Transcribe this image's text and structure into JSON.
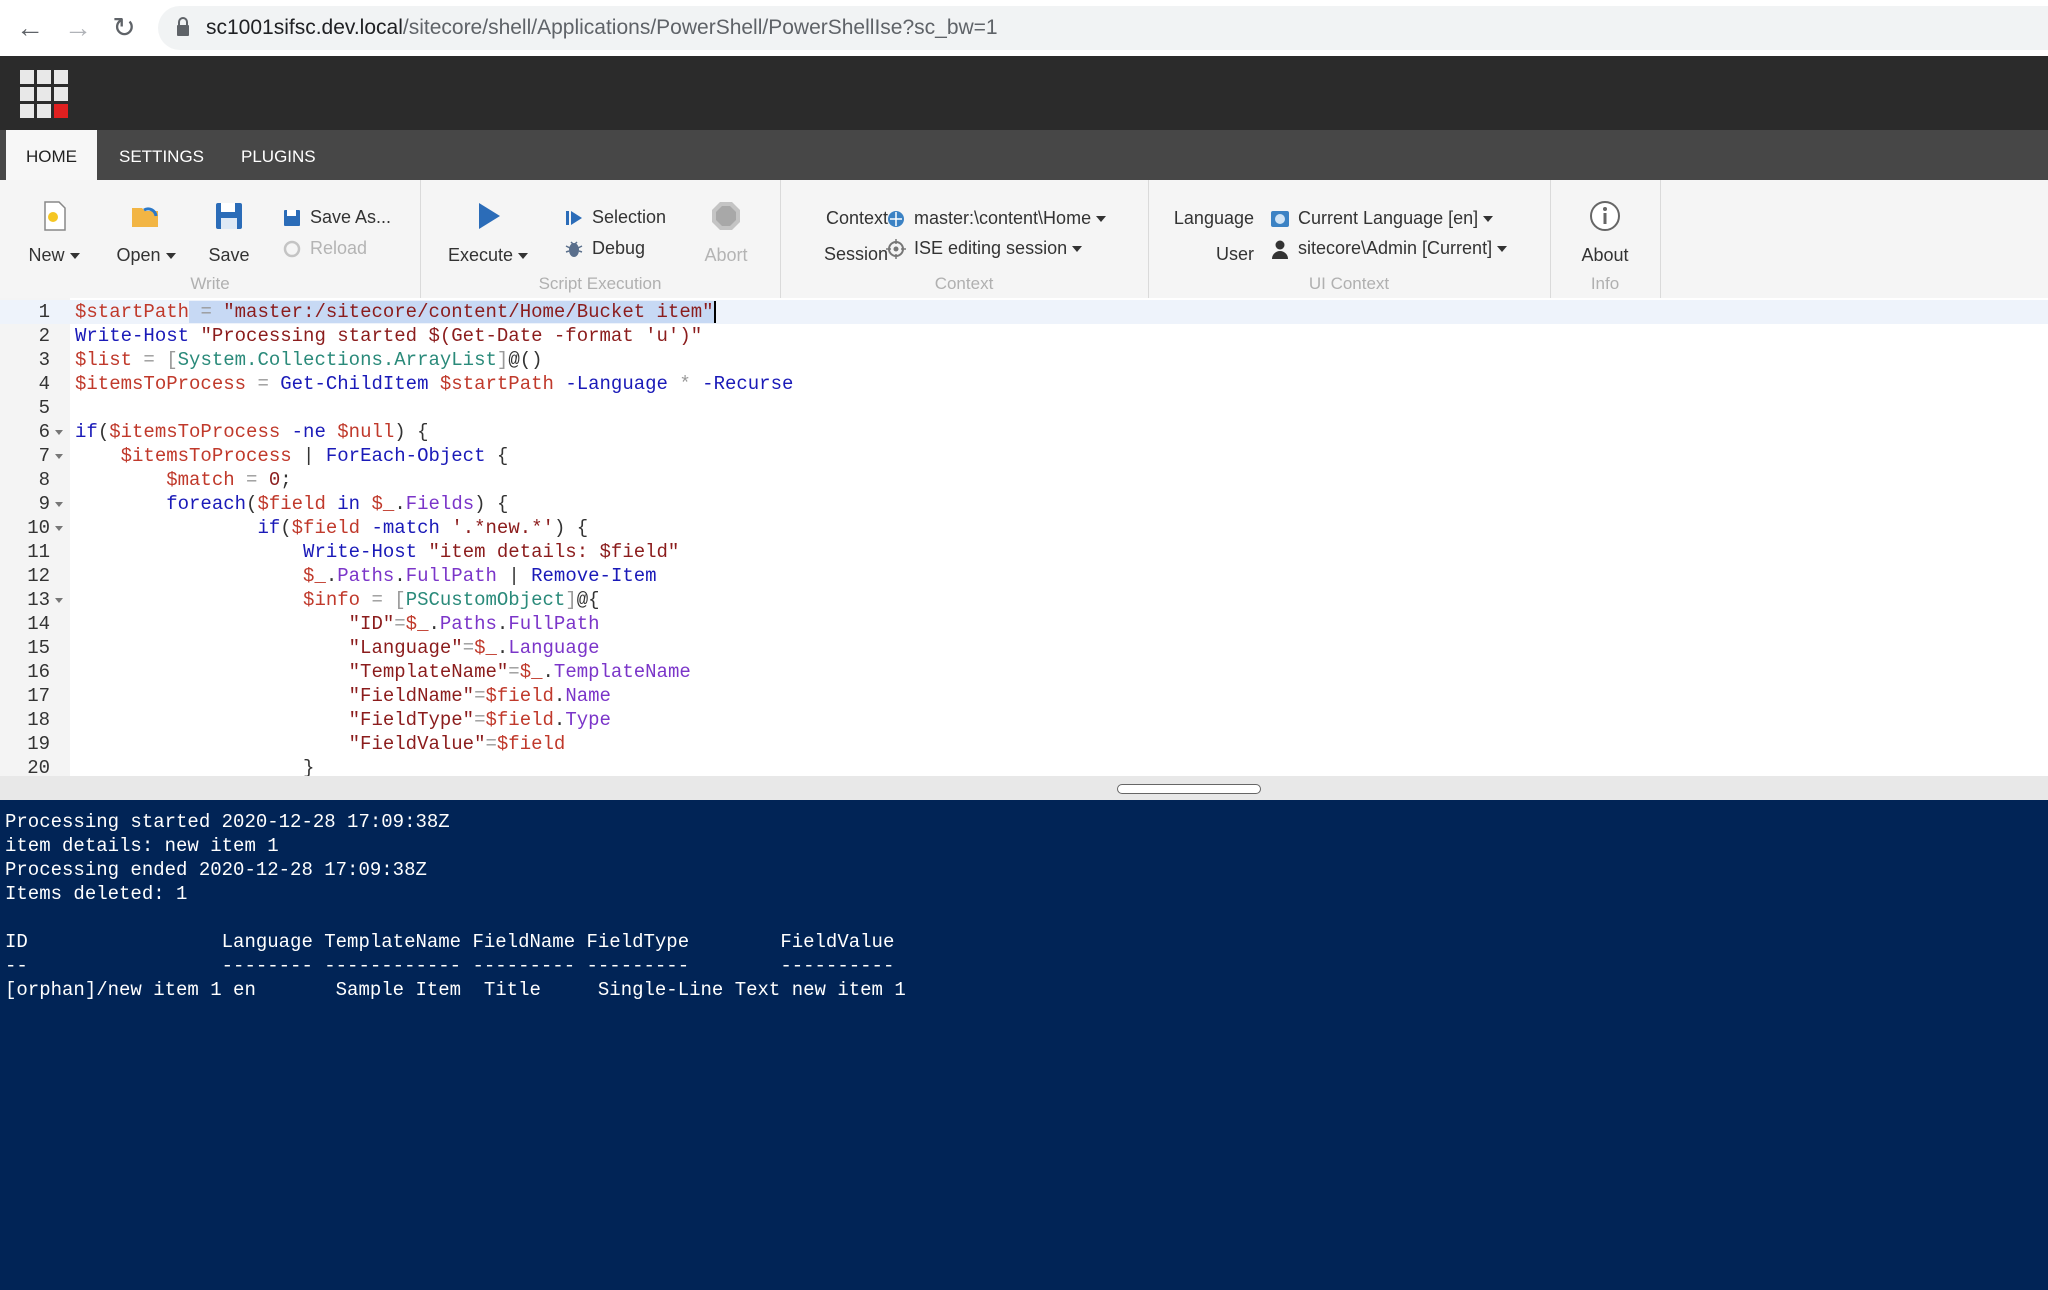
{
  "browser": {
    "url_host": "sc1001sifsc.dev.local",
    "url_path": "/sitecore/shell/Applications/PowerShell/PowerShellIse?sc_bw=1"
  },
  "tabs": [
    "HOME",
    "SETTINGS",
    "PLUGINS"
  ],
  "ribbon": {
    "write": {
      "new": "New",
      "open": "Open",
      "save": "Save",
      "save_as": "Save As...",
      "reload": "Reload",
      "label": "Write"
    },
    "script_execution": {
      "execute": "Execute",
      "selection": "Selection",
      "debug": "Debug",
      "abort": "Abort",
      "label": "Script Execution"
    },
    "context": {
      "context_label": "Context",
      "context_value": "master:\\content\\Home",
      "session_label": "Session",
      "session_value": "ISE editing session",
      "label": "Context"
    },
    "ui_context": {
      "language_label": "Language",
      "language_value": "Current Language [en]",
      "user_label": "User",
      "user_value": "sitecore\\Admin [Current]",
      "label": "UI Context"
    },
    "info": {
      "about": "About",
      "label": "Info"
    }
  },
  "editor": {
    "line_numbers": [
      "1",
      "2",
      "3",
      "4",
      "5",
      "6",
      "7",
      "8",
      "9",
      "10",
      "11",
      "12",
      "13",
      "14",
      "15",
      "16",
      "17",
      "18",
      "19",
      "20"
    ],
    "lines": [
      "$startPath = \"master:/sitecore/content/Home/Bucket item\"",
      "Write-Host \"Processing started $(Get-Date -format 'u')\"",
      "$list = [System.Collections.ArrayList]@()",
      "$itemsToProcess = Get-ChildItem $startPath -Language * -Recurse",
      "",
      "if($itemsToProcess -ne $null) {",
      "    $itemsToProcess | ForEach-Object {",
      "        $match = 0;",
      "        foreach($field in $_.Fields) {",
      "                if($field -match '.*new.*') {",
      "                    Write-Host \"item details: $field\"",
      "                    $_.Paths.FullPath | Remove-Item",
      "                    $info = [PSCustomObject]@{",
      "                        \"ID\"=$_.Paths.FullPath",
      "                        \"Language\"=$_.Language",
      "                        \"TemplateName\"=$_.TemplateName",
      "                        \"FieldName\"=$field.Name",
      "                        \"FieldType\"=$field.Type",
      "                        \"FieldValue\"=$field",
      "                    }"
    ]
  },
  "console": {
    "lines": [
      "Processing started 2020-12-28 17:09:38Z",
      "item details: new item 1",
      "Processing ended 2020-12-28 17:09:38Z",
      "Items deleted: 1",
      "",
      "ID                 Language TemplateName FieldName FieldType        FieldValue",
      "--                 -------- ------------ --------- ---------        ----------",
      "[orphan]/new item 1 en       Sample Item  Title     Single-Line Text new item 1"
    ]
  },
  "colors": {
    "console_bg": "#012456",
    "appbar_bg": "#2b2b2b",
    "tabbar_bg": "#474747"
  }
}
